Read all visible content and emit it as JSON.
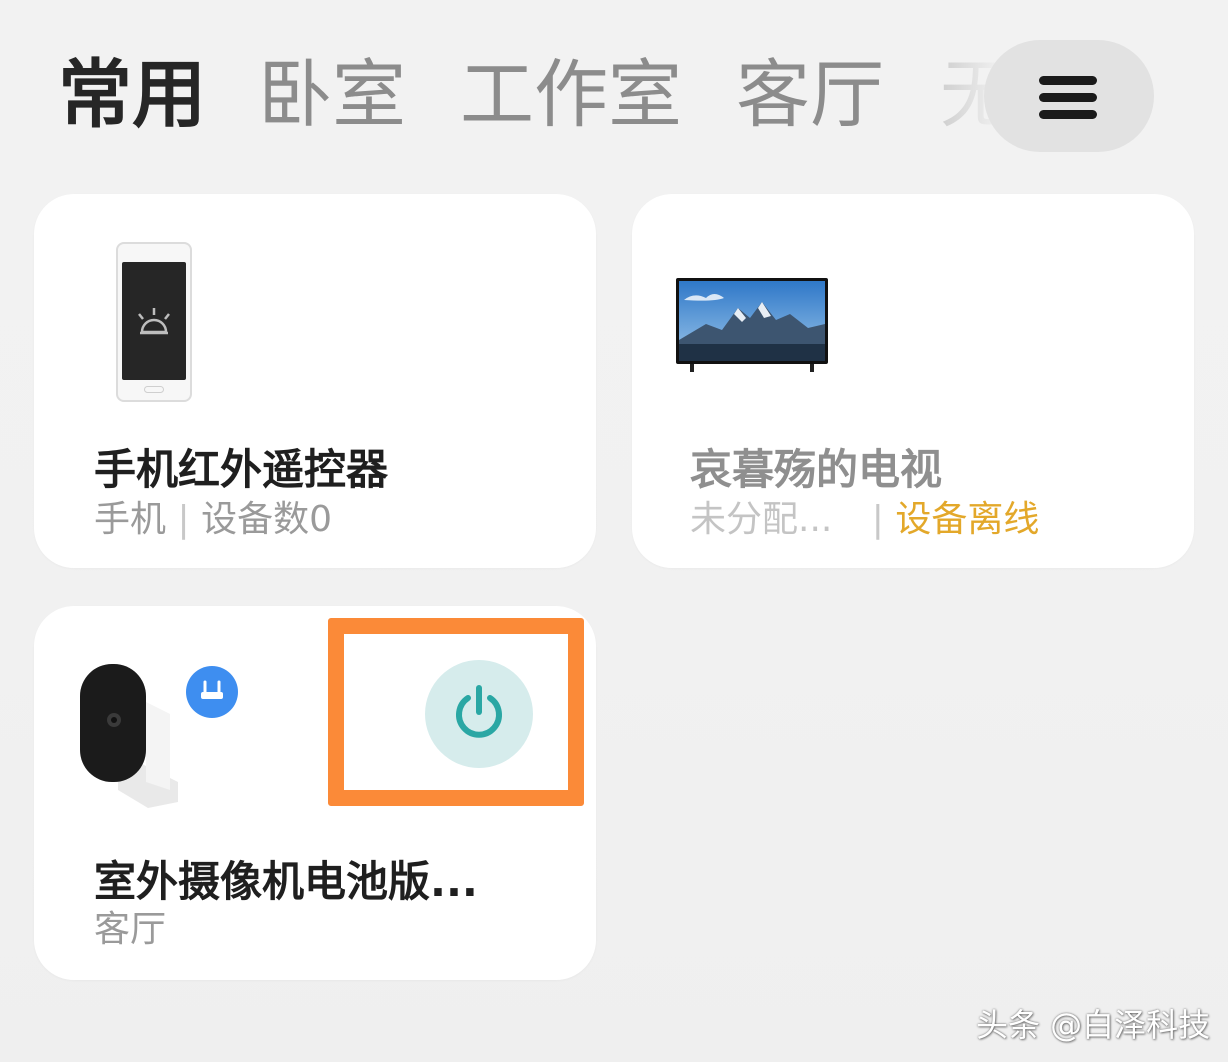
{
  "tabs": [
    {
      "label": "常用",
      "active": true
    },
    {
      "label": "卧室",
      "active": false
    },
    {
      "label": "工作室",
      "active": false
    },
    {
      "label": "客厅",
      "active": false
    },
    {
      "label": "无",
      "active": false
    }
  ],
  "menu": {
    "icon": "hamburger-menu-icon"
  },
  "devices": [
    {
      "name": "手机红外遥控器",
      "room": "手机",
      "separator": "|",
      "status": "设备数0",
      "icon": "phone-icon"
    },
    {
      "name": "哀暮殇的电视",
      "room": "未分配...",
      "separator": "|",
      "status": "设备离线",
      "status_color": "#e3a82a",
      "icon": "tv-icon"
    },
    {
      "name": "室外摄像机电池版...",
      "room": "客厅",
      "icon": "camera-icon",
      "badge_icon": "router-icon",
      "power_icon": "power-icon",
      "highlight_color": "#fb8a38"
    }
  ],
  "watermark": "头条 @白泽科技"
}
